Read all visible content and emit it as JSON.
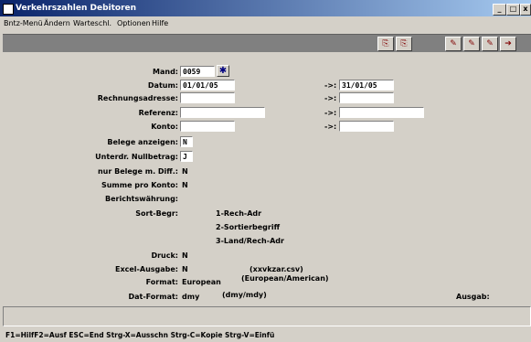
{
  "window": {
    "title": "Verkehrszahlen Debitoren",
    "minimize_glyph": "_",
    "maximize_glyph": "□",
    "close_glyph": "x"
  },
  "menu": {
    "items": [
      {
        "label": "Bntz-Menü"
      },
      {
        "label": "Ändern"
      },
      {
        "label": "Warteschl."
      },
      {
        "label": "Optionen"
      },
      {
        "label": "Hilfe"
      }
    ]
  },
  "toolbar": {
    "buttons": [
      {
        "icon": "copy-icon"
      },
      {
        "icon": "paste-icon"
      },
      {
        "icon": "tool-icon"
      },
      {
        "icon": "tool-icon"
      },
      {
        "icon": "tool-icon"
      },
      {
        "icon": "exit-icon"
      }
    ]
  },
  "form": {
    "mand_label": "Mand:",
    "mand_value": "0059",
    "datum_label": "Datum:",
    "datum_from": "01/01/05",
    "datum_to": "31/01/05",
    "range_arrow": "->:",
    "rechnungsadresse_label": "Rechnungsadresse:",
    "referenz_label": "Referenz:",
    "konto_label": "Konto:",
    "belege_anzeigen_label": "Belege anzeigen:",
    "belege_anzeigen_value": "N",
    "unterdr_label": "Unterdr. Nullbetrag:",
    "unterdr_value": "J",
    "nur_belege_label": "nur Belege m. Diff.:",
    "nur_belege_value": "N",
    "summe_label": "Summe pro Konto:",
    "summe_value": "N",
    "berichts_label": "Berichtswährung:",
    "sort_label": "Sort-Begr:",
    "sort_options": [
      "1-Rech-Adr",
      "2-Sortierbegriff",
      "3-Land/Rech-Adr"
    ],
    "druck_label": "Druck:",
    "druck_value": "N",
    "excel_label": "Excel-Ausgabe:",
    "excel_value": "N",
    "excel_hint": "(xxvkzar.csv)",
    "format_label": "Format:",
    "format_value": "European",
    "format_hint": "(European/American)",
    "datformat_label": "Dat-Format:",
    "datformat_value": "dmy",
    "datformat_hint": "(dmy/mdy)",
    "ausgab_label": "Ausgab:"
  },
  "statusbar": {
    "text": "F1=HilfF2=Ausf ESC=End Strg-X=Ausschn Strg-C=Kopie Strg-V=Einfü"
  }
}
